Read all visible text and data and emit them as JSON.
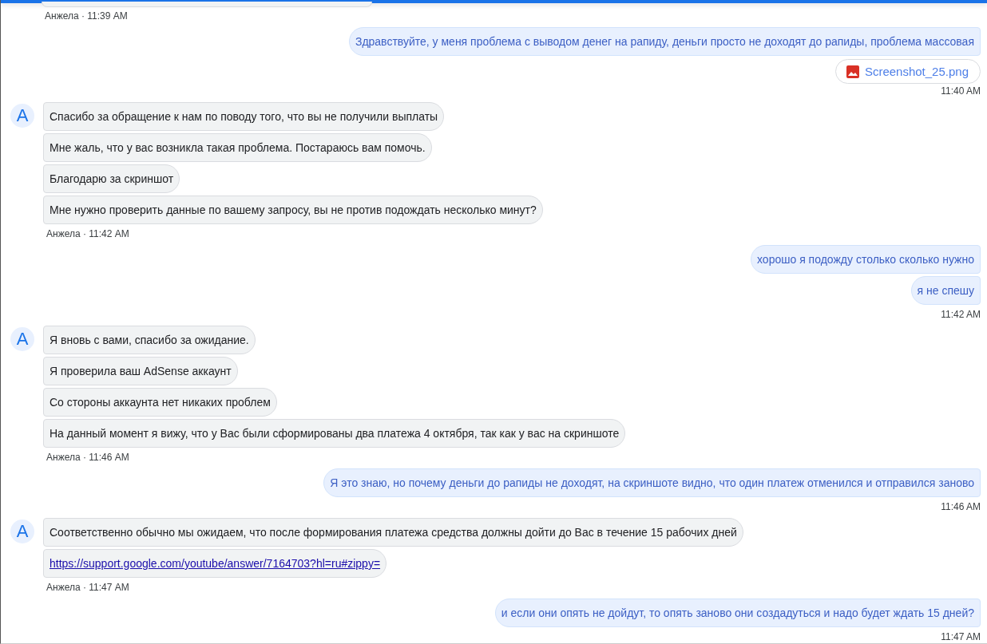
{
  "top_meta": "Анжела · 11:39 AM",
  "groups": [
    {
      "kind": "user",
      "messages": [
        {
          "kind": "text",
          "text": "Здравствуйте, у меня проблема с выводом денег на рапиду, деньги просто не доходят до рапиды, проблема массовая"
        },
        {
          "kind": "attachment",
          "text": "Screenshot_25.png"
        }
      ],
      "meta": "11:40 AM"
    },
    {
      "kind": "agent",
      "avatar_letter": "A",
      "messages": [
        {
          "kind": "text",
          "text": "Спасибо за обращение к нам по поводу того, что вы не получили выплаты"
        },
        {
          "kind": "text",
          "text": "Мне жаль, что у вас возникла такая проблема. Постараюсь вам помочь."
        },
        {
          "kind": "text",
          "text": "Благодарю за скриншот"
        },
        {
          "kind": "text",
          "text": "Мне нужно проверить данные по вашему запросу, вы не против подождать несколько минут?"
        }
      ],
      "meta": "Анжела · 11:42 AM"
    },
    {
      "kind": "user",
      "messages": [
        {
          "kind": "text",
          "text": "хорошо я подожду столько сколько нужно"
        },
        {
          "kind": "text",
          "text": "я не спешу"
        }
      ],
      "meta": "11:42 AM"
    },
    {
      "kind": "agent",
      "avatar_letter": "A",
      "messages": [
        {
          "kind": "text",
          "text": "Я вновь с вами, спасибо за ожидание."
        },
        {
          "kind": "text",
          "text": "Я проверила ваш AdSense аккаунт"
        },
        {
          "kind": "text",
          "text": "Со стороны аккаунта нет никаких проблем"
        },
        {
          "kind": "text",
          "text": "На данный момент я вижу, что у Вас были сформированы два платежа 4 октября, так как у вас на скриншоте"
        }
      ],
      "meta": "Анжела · 11:46 AM"
    },
    {
      "kind": "user",
      "messages": [
        {
          "kind": "text",
          "text": "Я это знаю, но почему деньги до рапиды не доходят, на скриншоте видно, что один платеж отменился и отправился заново"
        }
      ],
      "meta": "11:46 AM"
    },
    {
      "kind": "agent",
      "avatar_letter": "A",
      "messages": [
        {
          "kind": "text",
          "text": "Соответственно обычно мы ожидаем, что после формирования платежа средства должны дойти до Вас в течение 15 рабочих дней"
        },
        {
          "kind": "link",
          "text": "https://support.google.com/youtube/answer/7164703?hl=ru#zippy="
        }
      ],
      "meta": "Анжела · 11:47 AM"
    },
    {
      "kind": "user",
      "messages": [
        {
          "kind": "text",
          "text": "и если они опять не дойдут, то опять заново они создадуться и надо будет ждать 15 дней?"
        }
      ],
      "meta": "11:47 AM"
    }
  ]
}
